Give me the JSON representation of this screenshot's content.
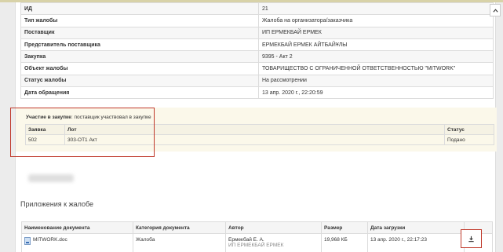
{
  "complaint_info": [
    {
      "key": "ИД",
      "value": "21"
    },
    {
      "key": "Тип жалобы",
      "value": "Жалоба на организатора/заказчика"
    },
    {
      "key": "Поставщик",
      "value": "ИП ЕРМЕКБАЙ ЕРМЕК"
    },
    {
      "key": "Представитель поставщика",
      "value": "ЕРМЕКБАЙ ЕРМЕК АЙТБАЙҰЛЫ"
    },
    {
      "key": "Закупка",
      "value": "9395 - Акт 2"
    },
    {
      "key": "Объект жалобы",
      "value": "ТОВАРИЩЕСТВО С ОГРАНИЧЕННОЙ ОТВЕТСТВЕННОСТЬЮ \"MITWORK\""
    },
    {
      "key": "Статус жалобы",
      "value": "На рассмотрении"
    },
    {
      "key": "Дата обращения",
      "value": "13 апр. 2020 г., 22:20:59"
    }
  ],
  "participation": {
    "label": "Участие в закупке",
    "text": ": поставщик участвовал в закупке",
    "headers": {
      "application": "Заявка",
      "lot": "Лот",
      "status": "Статус"
    },
    "row": {
      "application": "502",
      "lot": "303-ОТ1 Акт",
      "status": "Подано"
    }
  },
  "attachments": {
    "title": "Приложения к жалобе",
    "headers": {
      "name": "Наименование документа",
      "category": "Категория документа",
      "author": "Автор",
      "size": "Размер",
      "date": "Дата загрузки"
    },
    "row": {
      "name": "MITWORK.doc",
      "category": "Жалоба",
      "author": "Ермекбай Е. А.",
      "author_org": "ИП ЕРМЕКБАЙ ЕРМЕК",
      "size": "19,968 КБ",
      "date": "13 апр. 2020 г., 22:17:23"
    }
  },
  "icons": {
    "download": "download-icon",
    "file": "file-icon",
    "scroll_up": "chevron-up-icon"
  },
  "colors": {
    "highlight": "#c0392b",
    "participation_bg": "#fbf8ea"
  }
}
